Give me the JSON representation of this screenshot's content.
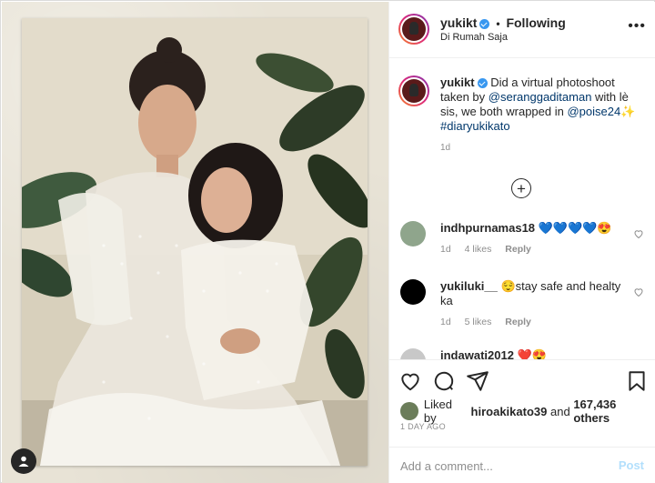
{
  "post": {
    "username": "yukikt",
    "separator": "•",
    "follow_status": "Following",
    "location": "Di Rumah Saja",
    "more_icon": "more-horizontal-icon"
  },
  "caption": {
    "username": "yukikt",
    "text_1": " Did a virtual photoshoot taken by ",
    "mention_1": "@seranggaditaman",
    "text_2": " with lè sis, we both wrapped in ",
    "mention_2": "@poise24",
    "sparkle": "✨",
    "hashtag": "#diaryukikato",
    "timestamp": "1d"
  },
  "load_more_icon": "plus-circle-icon",
  "comments": [
    {
      "username": "indhpurnamas18",
      "text": " 💙💙💙💙😍",
      "age": "1d",
      "likes": "4 likes",
      "reply": "Reply",
      "avatar_color": "#8fa58c"
    },
    {
      "username": "yukiluki__",
      "text": " 😌stay safe and healty ka",
      "age": "1d",
      "likes": "5 likes",
      "reply": "Reply",
      "avatar_color": "#000000"
    },
    {
      "username": "indawati2012",
      "text": " ❤️😍",
      "age": "",
      "likes": "",
      "reply": "",
      "avatar_color": "#c8c8c8"
    }
  ],
  "likes": {
    "prefix": "Liked by ",
    "user": "hiroakikato39",
    "mid": " and ",
    "count": "167,436 others"
  },
  "time_ago": "1 DAY AGO",
  "add_comment": {
    "placeholder": "Add a comment...",
    "post_label": "Post"
  },
  "colors": {
    "link": "#00376b",
    "verified": "#3897f0",
    "post_disabled": "#b2dffc"
  }
}
